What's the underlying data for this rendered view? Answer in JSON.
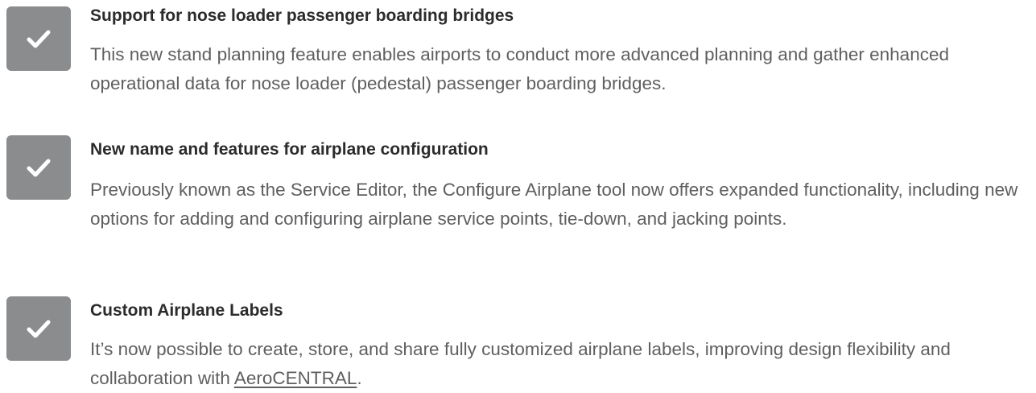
{
  "features": [
    {
      "title": "Support for nose loader passenger boarding bridges",
      "description": "This new stand planning feature enables airports to conduct more advanced planning and gather enhanced operational data for nose loader (pedestal) passenger boarding bridges.",
      "icon": "checkmark-icon"
    },
    {
      "title": "New name and features for airplane configuration",
      "description": "Previously known as the Service Editor, the Configure Airplane tool now offers expanded functionality, including new options for adding and configuring airplane service points, tie-down, and jacking points.",
      "icon": "checkmark-icon"
    },
    {
      "title": "Custom Airplane Labels",
      "description_before_link": "It’s now possible to create, store, and share fully customized airplane labels, improving design flexibility and collaboration with ",
      "link_text": "AeroCENTRAL",
      "description_after_link": ".",
      "icon": "checkmark-icon"
    }
  ],
  "colors": {
    "checkbox_bg": "#8b8c8e",
    "check_mark": "#ffffff",
    "title_text": "#2b2b2d",
    "body_text": "#5f5f61"
  }
}
